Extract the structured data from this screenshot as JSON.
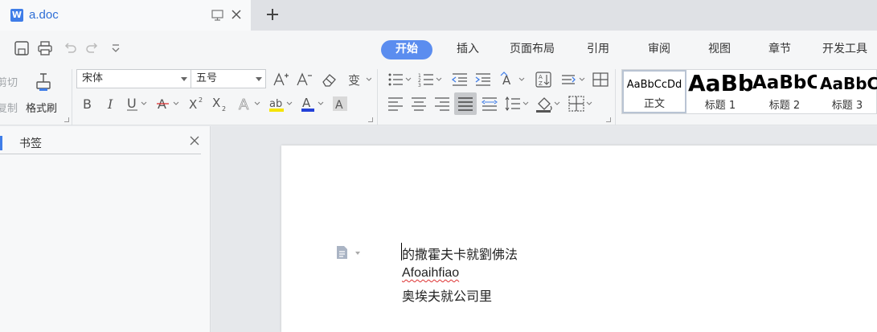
{
  "tab": {
    "title": "a.doc"
  },
  "menu": [
    "开始",
    "插入",
    "页面布局",
    "引用",
    "审阅",
    "视图",
    "章节",
    "开发工具"
  ],
  "clipboard": {
    "cut": "剪切",
    "copy": "复制",
    "format_painter": "格式刷"
  },
  "font": {
    "family": "宋体",
    "size": "五号"
  },
  "styles": [
    {
      "preview": "AaBbCcDd",
      "name": "正文"
    },
    {
      "preview": "AaBb",
      "name": "标题 1"
    },
    {
      "preview": "AaBbC",
      "name": "标题 2"
    },
    {
      "preview": "AaBbC",
      "name": "标题 3"
    }
  ],
  "pane": {
    "title": "书签"
  },
  "document": {
    "lines": [
      "的撒霍夫卡就劉佛法",
      "Afoaihfiao",
      "奥埃夫就公司里"
    ]
  },
  "colors": {
    "accent": "#5b8def",
    "brand": "#3f7de8",
    "highlight": "#f5e400",
    "font_color": "#2341d8"
  }
}
